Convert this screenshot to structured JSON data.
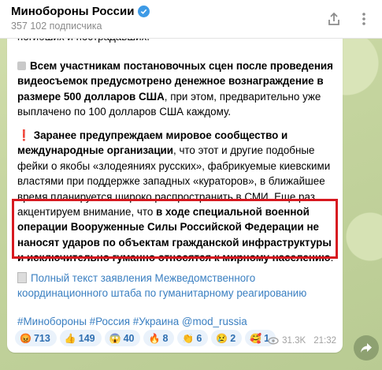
{
  "header": {
    "title": "Минобороны России",
    "subscribers": "357 102 подписчика"
  },
  "message": {
    "cut_line": "погибших и пострадавших.",
    "para1": {
      "bold": "Всем участникам постановочных сцен после проведения видеосъемок предусмотрено денежное вознаграждение в размере 500 долларов США",
      "normal": ", при этом, предварительно уже выплачено по 100 долларов США каждому."
    },
    "para2": {
      "bold1": "Заранее предупреждаем мировое сообщество и международные организации",
      "normal1": ", что этот и другие подобные фейки о якобы «злодеяниях русских», фабрикуемые киевскими властями при поддержке западных «кураторов», в ближайшее время планируется широко распространить в СМИ. Еще раз акцентируем внимание, что ",
      "bold2": "в ходе специальной военной операции Вооруженные Силы Российской Федерации не наносят ударов по объектам гражданской инфраструктуры и исключительно гуманно относятся к мирному населению",
      "end": "."
    },
    "link_text": "Полный текст заявления Межведомственного координационного штаба по гуманитарному реагированию",
    "hashtags": "#Минобороны #Россия #Украина @mod_russia",
    "reactions": [
      {
        "emoji": "😡",
        "count": "713"
      },
      {
        "emoji": "👍",
        "count": "149"
      },
      {
        "emoji": "😱",
        "count": "40"
      },
      {
        "emoji": "🔥",
        "count": "8"
      },
      {
        "emoji": "👏",
        "count": "6"
      },
      {
        "emoji": "😢",
        "count": "2"
      },
      {
        "emoji": "🥰",
        "count": "1"
      }
    ],
    "views": "31.3K",
    "time": "21:32"
  },
  "icons": [
    "verified-icon",
    "share-icon",
    "more-icon",
    "eye-icon",
    "forward-icon"
  ],
  "colors": {
    "link": "#3a7fc1",
    "highlight_border": "#d71920",
    "reaction_bg": "#eaf2fb"
  }
}
